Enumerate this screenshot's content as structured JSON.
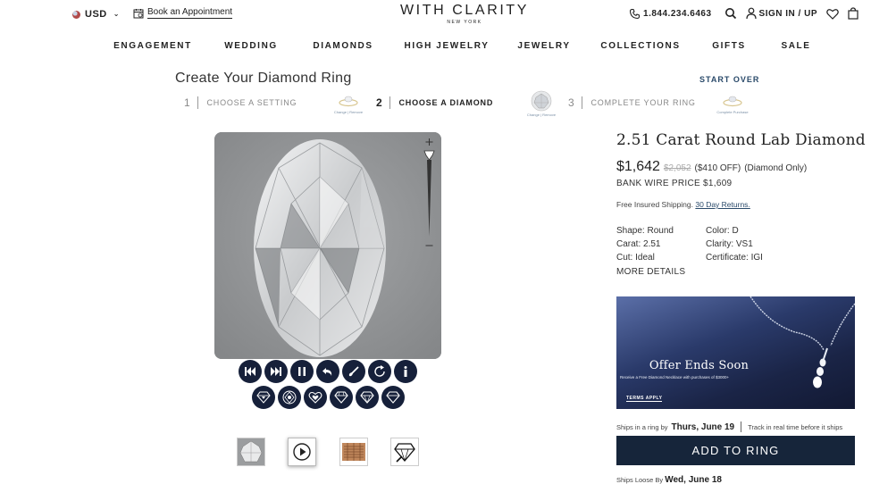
{
  "header": {
    "currency": "USD",
    "book_appointment": "Book an Appointment",
    "logo_main": "WITH CLARITY",
    "logo_sub": "NEW YORK",
    "phone": "1.844.234.6463",
    "signin": "SIGN IN / UP"
  },
  "nav": {
    "items": [
      "ENGAGEMENT",
      "WEDDING",
      "DIAMONDS",
      "HIGH JEWELRY",
      "JEWELRY",
      "COLLECTIONS",
      "GIFTS",
      "SALE"
    ]
  },
  "builder": {
    "title": "Create Your Diamond Ring",
    "start_over": "START OVER",
    "steps": [
      {
        "num": "1",
        "label": "CHOOSE A SETTING",
        "links": "Change | Remove"
      },
      {
        "num": "2",
        "label": "CHOOSE A DIAMOND",
        "links": "Change | Remove"
      },
      {
        "num": "3",
        "label": "COMPLETE YOUR RING",
        "links": "Complete Purchase"
      }
    ]
  },
  "viewer": {
    "controls_row1": [
      "skip-back-icon",
      "skip-forward-icon",
      "pause-icon",
      "undo-icon",
      "brush-icon",
      "rotate-icon",
      "info-icon"
    ],
    "controls_row2": [
      "diamond-top-icon",
      "diamond-face-icon",
      "heart-arrows-icon",
      "diamond-side-icon",
      "diamond-outline-icon",
      "diamond-plain-icon"
    ],
    "thumbnails": [
      "diamond-photo-thumb",
      "video-play-thumb",
      "certificate-thumb",
      "diamond-diagram-thumb"
    ]
  },
  "product": {
    "title": "2.51 Carat Round Lab Diamond",
    "price": "$1,642",
    "old_price": "$2,052",
    "discount": "($410 OFF)",
    "price_note": "(Diamond Only)",
    "bank_wire": "BANK WIRE PRICE $1,609",
    "shipping_text": "Free Insured Shipping.",
    "returns_link": "30 Day Returns.",
    "specs": [
      [
        "Shape: Round",
        "Color: D"
      ],
      [
        "Carat: 2.51",
        "Clarity: VS1"
      ],
      [
        "Cut: Ideal",
        "Certificate: IGI"
      ]
    ],
    "more_details": "MORE DETAILS",
    "promo": {
      "title": "Offer Ends Soon",
      "subtitle": "Receive a Free Diamond Necklace with purchases of $3000+",
      "terms": "TERMS APPLY"
    },
    "ships_ring_prefix": "Ships in a ring by",
    "ships_ring_date": "Thurs, June 19",
    "track_text": "Track in real time before it ships",
    "add_to_ring": "ADD TO RING",
    "ships_loose_prefix": "Ships Loose By",
    "ships_loose_date": "Wed, June 18"
  },
  "colors": {
    "navy": "#16253a",
    "link": "#2a4a6a"
  }
}
